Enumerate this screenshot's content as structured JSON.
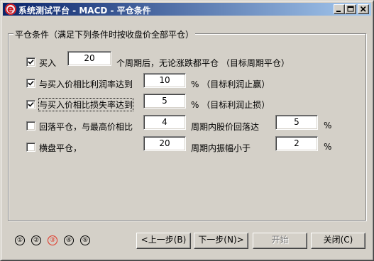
{
  "window": {
    "title": "系统测试平台 - MACD - 平仓条件"
  },
  "group": {
    "title": "平仓条件（满足下列条件时按收盘价全部平仓）"
  },
  "conditions": [
    {
      "checked": true,
      "label": "买入",
      "value": "20",
      "suffix": "个周期后，无论涨跌都平仓 （目标周期平仓）"
    },
    {
      "checked": true,
      "label": "与买入价相比利润率达到",
      "value": "10",
      "suffix": "% （目标利润止赢）"
    },
    {
      "checked": true,
      "label": "与买入价相比损失率达到",
      "value": "5",
      "suffix": "% （目标利润止损）"
    },
    {
      "checked": false,
      "label": "回落平仓，与最高价相比",
      "value": "4",
      "middle": "周期内股价回落达",
      "value2": "5",
      "suffix": "%"
    },
    {
      "checked": false,
      "label": "横盘平仓，",
      "value": "20",
      "middle": "周期内振幅小于",
      "value2": "2",
      "suffix": "%"
    }
  ],
  "steps": [
    "①",
    "②",
    "③",
    "④",
    "⑤"
  ],
  "current_step": 3,
  "buttons": {
    "prev": "<上一步(B)",
    "next": "下一步(N)>",
    "start": "开始",
    "close": "关闭(C)"
  },
  "colors": {
    "titlebar_start": "#0a246a",
    "titlebar_end": "#a6caf0",
    "face": "#d4d0c8",
    "current_step": "#e03020"
  }
}
